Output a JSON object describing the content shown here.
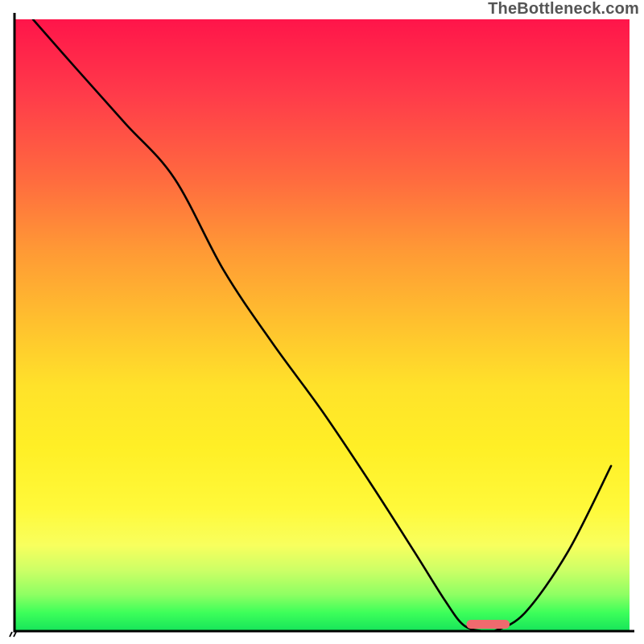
{
  "watermark": "TheBottleneck.com",
  "chart_data": {
    "type": "line",
    "title": "",
    "xlabel": "",
    "ylabel": "",
    "xlim": [
      0,
      100
    ],
    "ylim": [
      0,
      100
    ],
    "grid": false,
    "legend": false,
    "series": [
      {
        "name": "bottleneck-curve",
        "x": [
          3,
          10,
          18,
          26,
          34,
          42,
          50,
          58,
          65,
          70,
          73,
          76,
          78,
          83,
          90,
          97
        ],
        "values": [
          100,
          92,
          83,
          74,
          59,
          47,
          36,
          24,
          13,
          5,
          1,
          0,
          0,
          3,
          13,
          27
        ]
      }
    ],
    "marker": {
      "name": "optimal-range",
      "x_center": 77,
      "width": 7,
      "color": "#ef6a6e"
    },
    "gradient_stops": {
      "top_color": "#ff154a",
      "mid_color": "#ffe22a",
      "bottom_color": "#16e45a"
    },
    "axis_color": "#000000"
  }
}
